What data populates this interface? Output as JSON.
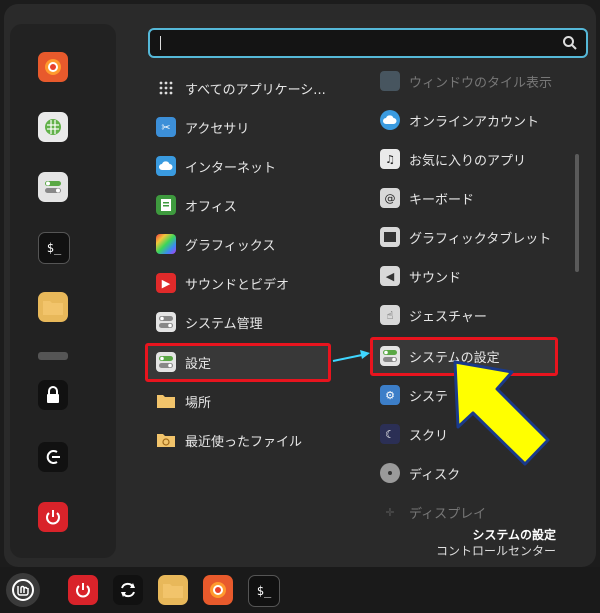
{
  "search": {
    "placeholder": "",
    "value": ""
  },
  "categories": [
    {
      "label": "すべてのアプリケーシ...",
      "icon": "grid-icon"
    },
    {
      "label": "アクセサリ",
      "icon": "scissors-icon"
    },
    {
      "label": "インターネット",
      "icon": "cloud-icon"
    },
    {
      "label": "オフィス",
      "icon": "document-icon"
    },
    {
      "label": "グラフィックス",
      "icon": "palette-icon"
    },
    {
      "label": "サウンドとビデオ",
      "icon": "play-icon"
    },
    {
      "label": "システム管理",
      "icon": "toggle-icon"
    },
    {
      "label": "設定",
      "icon": "toggle-icon"
    },
    {
      "label": "場所",
      "icon": "folder-icon"
    },
    {
      "label": "最近使ったファイル",
      "icon": "recent-folder-icon"
    }
  ],
  "apps": [
    {
      "label": "ウィンドウのタイル表示",
      "icon": "window-tile-icon"
    },
    {
      "label": "オンラインアカウント",
      "icon": "cloud-icon"
    },
    {
      "label": "お気に入りのアプリ",
      "icon": "music-note-icon"
    },
    {
      "label": "キーボード",
      "icon": "keyboard-icon"
    },
    {
      "label": "グラフィックタブレット",
      "icon": "tablet-icon"
    },
    {
      "label": "サウンド",
      "icon": "speaker-icon"
    },
    {
      "label": "ジェスチャー",
      "icon": "hand-icon"
    },
    {
      "label": "システムの設定",
      "icon": "toggle-icon"
    },
    {
      "label": "システ",
      "icon": "gear-icon"
    },
    {
      "label": "スクリ",
      "icon": "moon-icon"
    },
    {
      "label": "ディスク",
      "icon": "disk-icon"
    },
    {
      "label": "ディスプレイ",
      "icon": "display-icon"
    }
  ],
  "description": {
    "title": "システムの設定",
    "subtitle": "コントロールセンター"
  },
  "colors": {
    "highlight_box": "#e8141e",
    "arrow": "#ffff00",
    "accent": "#55b8d8"
  }
}
